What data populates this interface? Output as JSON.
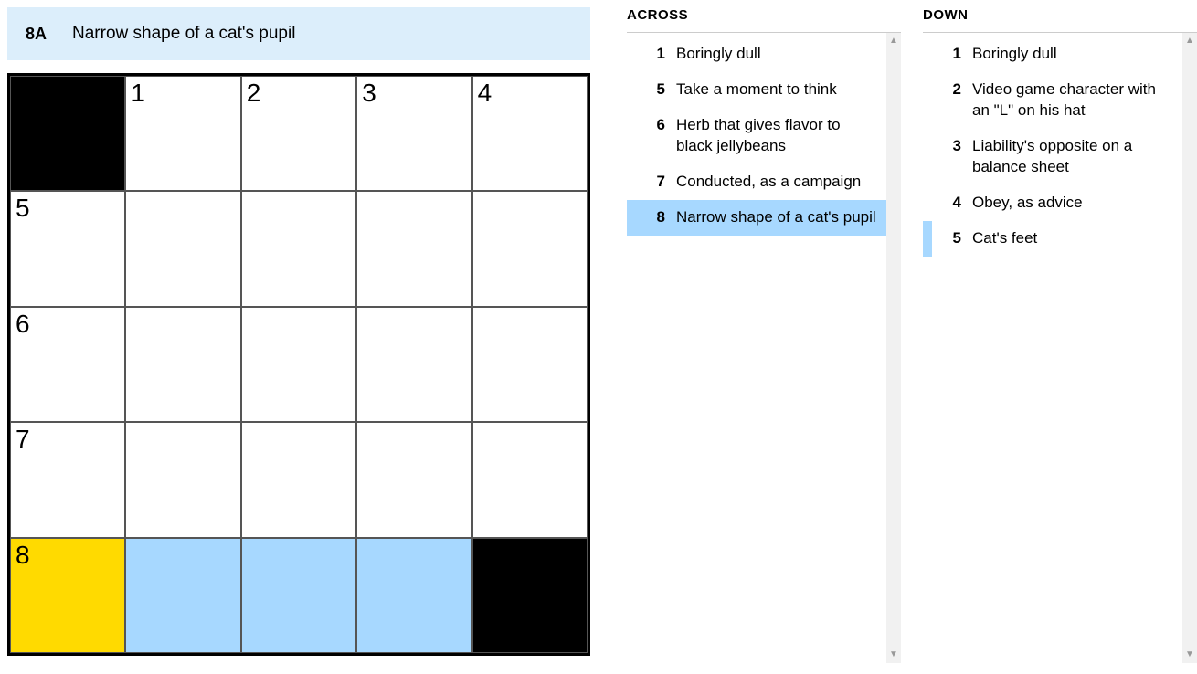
{
  "current_clue": {
    "id": "8A",
    "text": "Narrow shape of a cat's pupil"
  },
  "grid": {
    "rows": 5,
    "cols": 5,
    "cells": [
      [
        {
          "black": true
        },
        {
          "num": "1"
        },
        {
          "num": "2"
        },
        {
          "num": "3"
        },
        {
          "num": "4"
        }
      ],
      [
        {
          "num": "5"
        },
        {},
        {},
        {},
        {}
      ],
      [
        {
          "num": "6"
        },
        {},
        {},
        {},
        {}
      ],
      [
        {
          "num": "7"
        },
        {},
        {},
        {},
        {}
      ],
      [
        {
          "num": "8",
          "cursor": true
        },
        {
          "highlight": true
        },
        {
          "highlight": true
        },
        {
          "highlight": true
        },
        {
          "black": true
        }
      ]
    ]
  },
  "clues": {
    "across": {
      "header": "ACROSS",
      "items": [
        {
          "num": "1",
          "text": "Boringly dull"
        },
        {
          "num": "5",
          "text": "Take a moment to think"
        },
        {
          "num": "6",
          "text": "Herb that gives flavor to black jellybeans"
        },
        {
          "num": "7",
          "text": "Conducted, as a campaign"
        },
        {
          "num": "8",
          "text": "Narrow shape of a cat's pupil",
          "selected": true
        }
      ]
    },
    "down": {
      "header": "DOWN",
      "items": [
        {
          "num": "1",
          "text": "Boringly dull"
        },
        {
          "num": "2",
          "text": "Video game character with an \"L\" on his hat"
        },
        {
          "num": "3",
          "text": "Liability's opposite on a balance sheet"
        },
        {
          "num": "4",
          "text": "Obey, as advice"
        },
        {
          "num": "5",
          "text": "Cat's feet",
          "related": true
        }
      ]
    }
  }
}
